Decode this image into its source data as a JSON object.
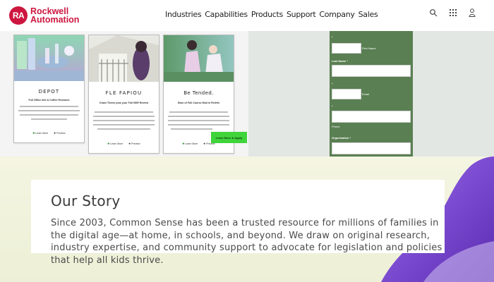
{
  "brand": {
    "mark": "RA",
    "line1": "Rockwell",
    "line2": "Automation",
    "color": "#cd163f"
  },
  "nav": [
    "Industries",
    "Capabilities",
    "Products",
    "Support",
    "Company",
    "Sales"
  ],
  "header_icons": [
    "search-icon",
    "apps-grid-icon",
    "user-icon"
  ],
  "cards": [
    {
      "title": "DEPOT",
      "subtitle": "Full Office Info & Coffee Research",
      "links": [
        "Learn More",
        "Preview"
      ]
    },
    {
      "title": "FLE FAPIOU",
      "subtitle": "Chain Theme plus your Full HDR Review",
      "links": [
        "Learn More",
        "Preview"
      ]
    },
    {
      "title": "Be Tended.",
      "subtitle": "Ease of Full Course Mod in Reliefs",
      "links": [
        "Learn More",
        "Preview"
      ]
    }
  ],
  "cta": "Learn More & Apply",
  "form": {
    "fields": [
      {
        "label": "*",
        "note": "First Name"
      },
      {
        "label": "Last Name *",
        "note": ""
      },
      {
        "label": "*",
        "note": "Email"
      },
      {
        "label": "*",
        "note": ""
      },
      {
        "label": "Organization *",
        "note": ""
      }
    ],
    "phone_label": "Phone"
  },
  "story": {
    "title": "Our Story",
    "body": "Since 2003, Common Sense has been a trusted resource for millions of families in the digital age—at home, in schools, and beyond. We draw on original research, industry expertise, and community support to advocate for legislation and policies that help all kids thrive."
  },
  "colors": {
    "form_green": "#5a7f52",
    "cta_green": "#3ed43a",
    "accent_purple": "#7d3fd6"
  }
}
